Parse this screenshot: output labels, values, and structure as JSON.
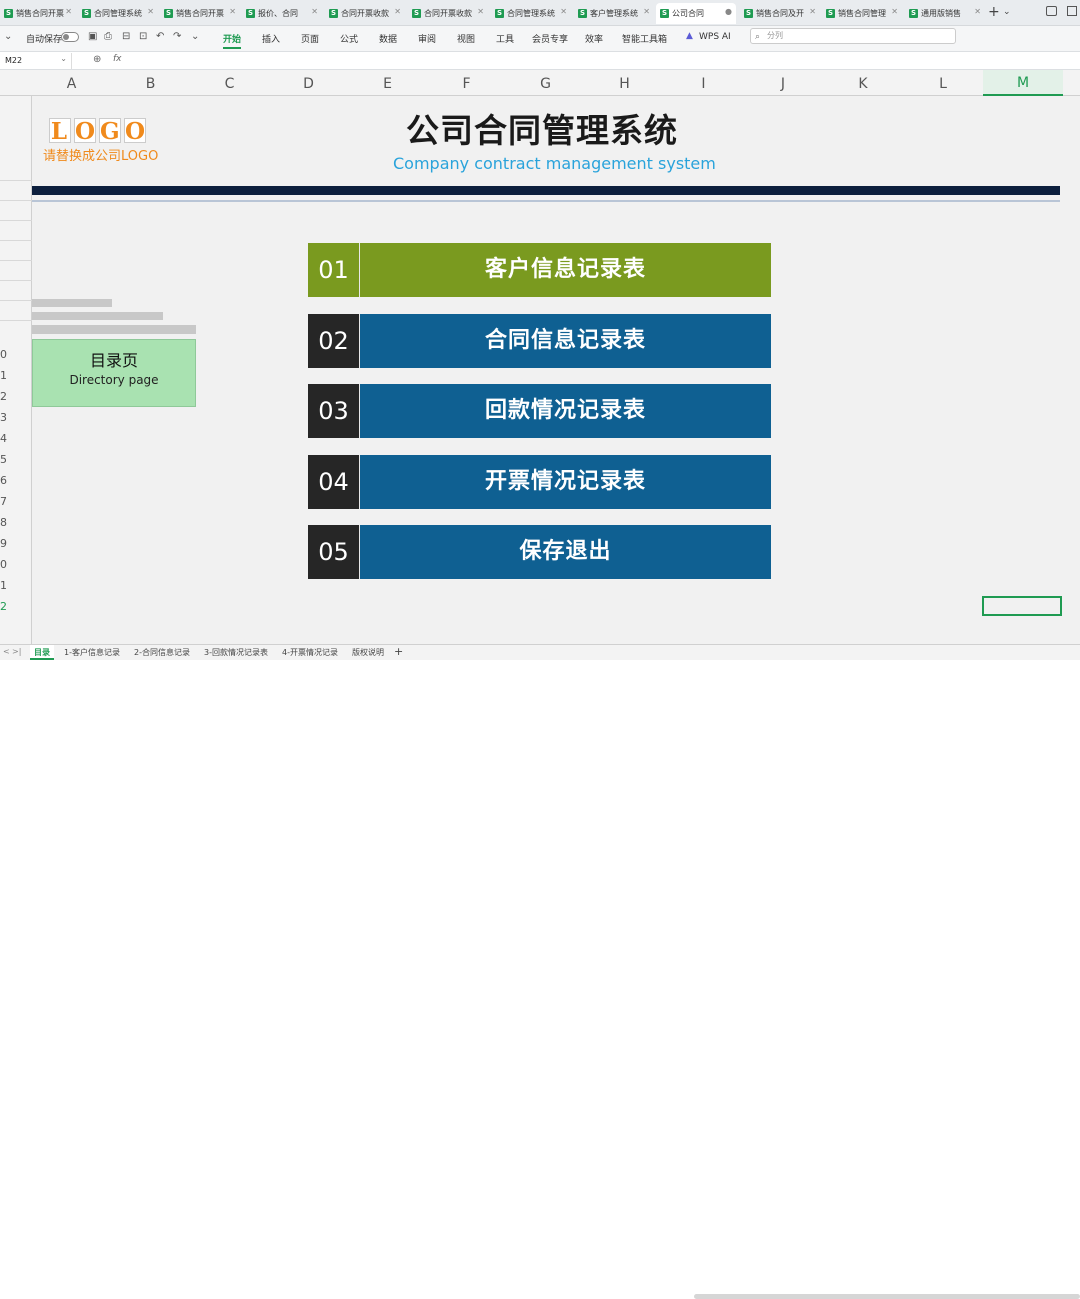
{
  "tabs": [
    {
      "label": "销售合同开票"
    },
    {
      "label": "合同管理系统"
    },
    {
      "label": "销售合同开票"
    },
    {
      "label": "报价、合同"
    },
    {
      "label": "合同开票收款"
    },
    {
      "label": "合同开票收款"
    },
    {
      "label": "合同管理系统"
    },
    {
      "label": "客户管理系统"
    },
    {
      "label": "公司合同"
    },
    {
      "label": "销售合同及开"
    },
    {
      "label": "销售合同管理"
    },
    {
      "label": "通用版销售"
    }
  ],
  "tab_active_index": 8,
  "ribbon": {
    "autosave": "自动保存",
    "menus": [
      "开始",
      "插入",
      "页面",
      "公式",
      "数据",
      "审阅",
      "视图",
      "工具",
      "会员专享",
      "效率",
      "智能工具箱"
    ],
    "wps_ai": "WPS AI",
    "search_placeholder": "分列"
  },
  "formula_bar": {
    "cell_ref": "M22",
    "fx": "fx"
  },
  "columns": [
    "A",
    "B",
    "C",
    "D",
    "E",
    "F",
    "G",
    "H",
    "I",
    "J",
    "K",
    "L",
    "M"
  ],
  "selected_column": "M",
  "rows": [
    "0",
    "1",
    "2",
    "3",
    "4",
    "5",
    "6",
    "7",
    "8",
    "9",
    "0",
    "1",
    "2"
  ],
  "logo": {
    "letters": [
      "L",
      "O",
      "G",
      "O"
    ],
    "subtitle": "请替换成公司LOGO"
  },
  "title": "公司合同管理系统",
  "subtitle": "Company contract management system",
  "directory": {
    "zh": "目录页",
    "en": "Directory page"
  },
  "menu": [
    {
      "num": "01",
      "label": "客户信息记录表",
      "num_color": "#7a9a1f",
      "label_color": "#7a9a1f"
    },
    {
      "num": "02",
      "label": "合同信息记录表",
      "num_color": "#262626",
      "label_color": "#0f6092"
    },
    {
      "num": "03",
      "label": "回款情况记录表",
      "num_color": "#262626",
      "label_color": "#0f6092"
    },
    {
      "num": "04",
      "label": "开票情况记录表",
      "num_color": "#262626",
      "label_color": "#0f6092"
    },
    {
      "num": "05",
      "label": "保存退出",
      "num_color": "#262626",
      "label_color": "#0f6092"
    }
  ],
  "sheets": [
    "目录",
    "1-客户信息记录",
    "2-合同信息记录",
    "3-回款情况记录表",
    "4-开票情况记录",
    "版权说明"
  ],
  "active_sheet": "目录",
  "colors": {
    "accent": "#1f9b52",
    "brand_orange": "#f08a1c",
    "title_blue": "#29a3db",
    "dark_band": "#0c1f3d"
  }
}
